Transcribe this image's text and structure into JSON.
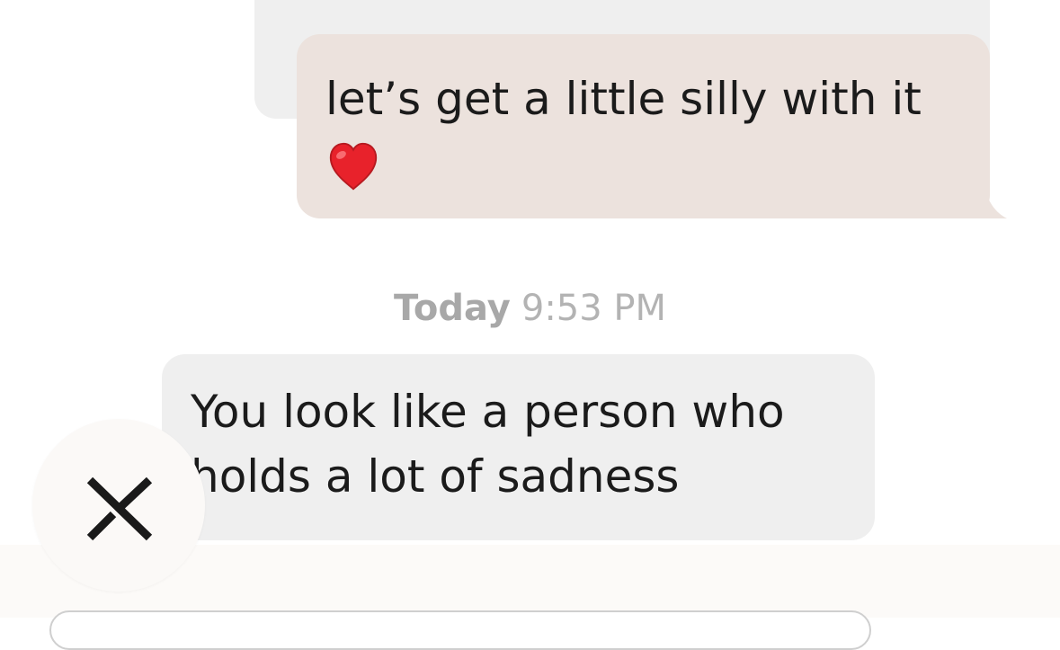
{
  "conversation": {
    "previous_message": {
      "text": ""
    },
    "sent_message": {
      "text": "let’s get a little silly with it",
      "emoji": "heart-emoji"
    },
    "timestamp": {
      "day": "Today",
      "time": "9:53 PM"
    },
    "received_message": {
      "line1": "You look like a person who",
      "line2": "holds a lot of sadness"
    }
  },
  "controls": {
    "close_icon": "close-icon",
    "message_input_placeholder": ""
  },
  "colors": {
    "sent_bubble": "#ece2dd",
    "received_bubble": "#efefef",
    "timestamp_text": "#b3b3b3",
    "text": "#1b1b1b",
    "heart": "#e8222b"
  }
}
